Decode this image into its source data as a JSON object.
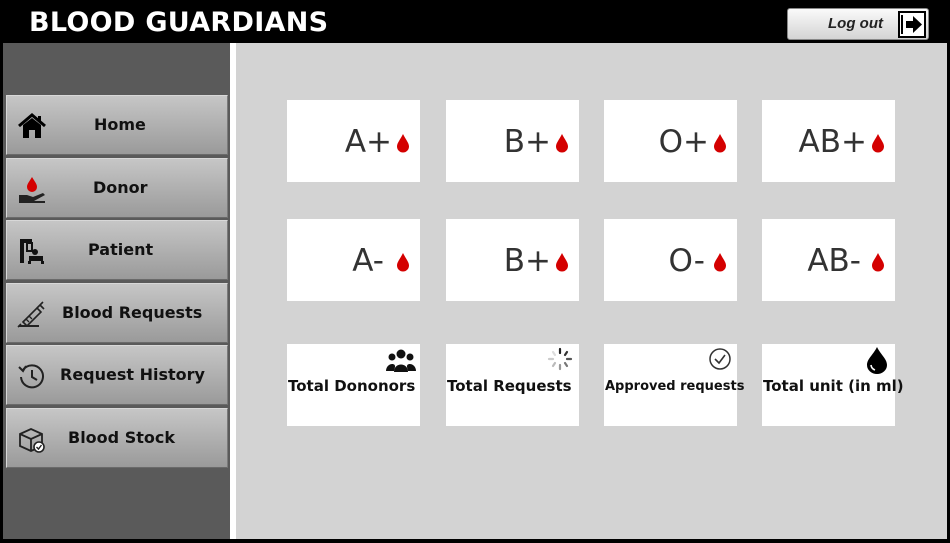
{
  "app": {
    "title": "BLOOD GUARDIANS",
    "logout_label": "Log out"
  },
  "sidebar": {
    "items": [
      {
        "label": "Home",
        "icon": "home-icon"
      },
      {
        "label": "Donor",
        "icon": "donor-hand-icon"
      },
      {
        "label": "Patient",
        "icon": "patient-icon"
      },
      {
        "label": "Blood Requests",
        "icon": "syringe-icon"
      },
      {
        "label": "Request History",
        "icon": "history-icon"
      },
      {
        "label": "Blood Stock",
        "icon": "blood-stock-box-icon"
      }
    ]
  },
  "blood_groups": [
    {
      "label": "A+"
    },
    {
      "label": "B+"
    },
    {
      "label": "O+"
    },
    {
      "label": "AB+"
    },
    {
      "label": "A-"
    },
    {
      "label": "B+"
    },
    {
      "label": "O-"
    },
    {
      "label": "AB-"
    }
  ],
  "stats": [
    {
      "label": "Total Dononors",
      "icon": "users-group-icon"
    },
    {
      "label": "Total Requests",
      "icon": "loading-spinner-icon"
    },
    {
      "label": "Approved requests",
      "icon": "check-circle-icon"
    },
    {
      "label": "Total unit (in ml)",
      "icon": "water-drop-icon"
    }
  ],
  "colors": {
    "accent_red": "#d40000",
    "sidebar_bg": "#5a5a5a",
    "main_bg": "#d3d3d3",
    "titlebar_bg": "#000000"
  }
}
